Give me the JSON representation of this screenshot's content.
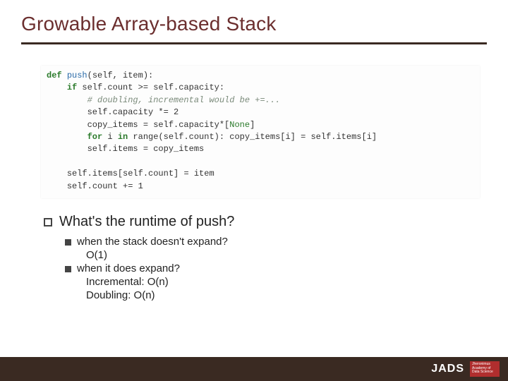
{
  "title": "Growable Array-based Stack",
  "code": {
    "l1_def": "def",
    "l1_fn": "push",
    "l1_rest": "(self, item):",
    "l2_if": "if",
    "l2_rest": " self.count >= self.capacity:",
    "l3_comment": "# doubling, incremental would be +=...",
    "l4": "self.capacity *= 2",
    "l5a": "copy_items = self.capacity*[",
    "l5b": "None",
    "l5c": "]",
    "l6_for": "for",
    "l6_mid": " i ",
    "l6_in": "in",
    "l6_rest": " range(self.count): copy_items[i] = self.items[i]",
    "l7": "self.items = copy_items",
    "l8": "self.items[self.count] = item",
    "l9": "self.count += 1"
  },
  "question": "What's the runtime of push?",
  "sub": {
    "a_q": "when the stack doesn't expand?",
    "a_ans": "O(1)",
    "b_q": "when it does expand?",
    "b_ans1": "Incremental: O(n)",
    "b_ans2": "Doubling: O(n)"
  },
  "footer": {
    "logo_text": "JADS",
    "red_box": "Jheronimus Academy of Data Science"
  }
}
